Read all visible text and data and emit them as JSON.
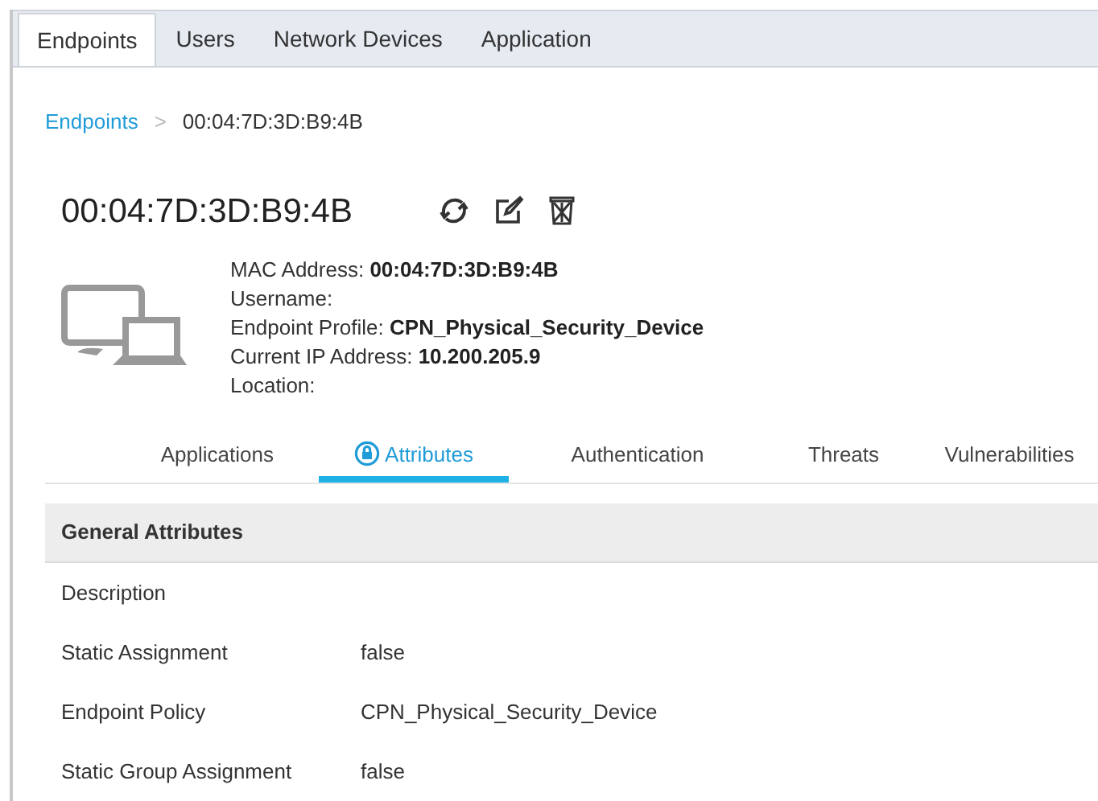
{
  "top_tabs": [
    {
      "label": "Endpoints",
      "selected": true
    },
    {
      "label": "Users",
      "selected": false
    },
    {
      "label": "Network Devices",
      "selected": false
    },
    {
      "label": "Application",
      "selected": false
    }
  ],
  "breadcrumb": {
    "link": "Endpoints",
    "separator": ">",
    "current": "00:04:7D:3D:B9:4B"
  },
  "title": "00:04:7D:3D:B9:4B",
  "details": [
    {
      "label": "MAC Address:",
      "value": "00:04:7D:3D:B9:4B"
    },
    {
      "label": "Username:"
    },
    {
      "label": "Endpoint Profile:",
      "value": "CPN_Physical_Security_Device"
    },
    {
      "label": "Current IP Address:",
      "value": "10.200.205.9"
    },
    {
      "label": "Location:"
    }
  ],
  "sub_tabs": [
    {
      "label": "Applications",
      "selected": false
    },
    {
      "label": "Attributes",
      "selected": true
    },
    {
      "label": "Authentication",
      "selected": false
    },
    {
      "label": "Threats",
      "selected": false
    },
    {
      "label": "Vulnerabilities",
      "selected": false
    }
  ],
  "section": {
    "title": "General Attributes",
    "rows": [
      {
        "name": "Description"
      },
      {
        "name": "Static Assignment",
        "value": "false"
      },
      {
        "name": "Endpoint Policy",
        "value": "CPN_Physical_Security_Device"
      },
      {
        "name": "Static Group Assignment",
        "value": "false"
      }
    ]
  }
}
